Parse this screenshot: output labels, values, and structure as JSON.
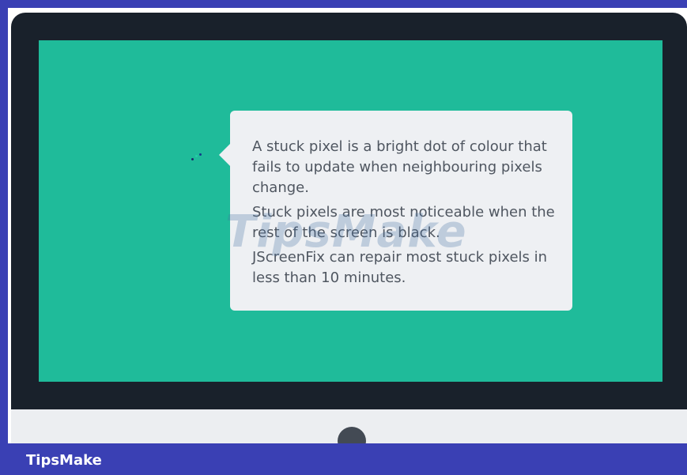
{
  "brand": {
    "name": "TipsMake"
  },
  "watermark": {
    "text": "TipsMake"
  },
  "bubble": {
    "paragraphs": [
      "A stuck pixel is a bright dot of colour that fails to update when neighbouring pixels change.",
      "Stuck pixels are most noticeable when the rest of the screen is black.",
      "JScreenFix can repair most stuck pixels in less than 10 minutes."
    ]
  },
  "colors": {
    "screen": "#1fbb9a",
    "bezel": "#19212b",
    "footer": "#3a40b4",
    "bubble": "#eef0f3",
    "text": "#4f5660"
  },
  "icons": {
    "power": "power-button-icon",
    "pixels": "stuck-pixel-dots-icon"
  }
}
